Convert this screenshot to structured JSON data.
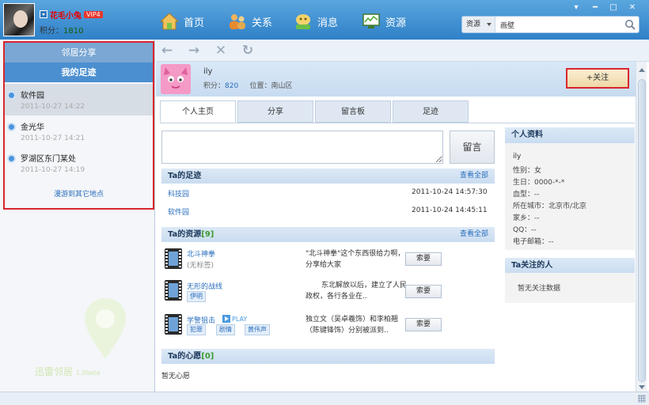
{
  "user": {
    "name": "花毛小兔",
    "vip": "VIP4",
    "score_label": "积分：",
    "score": "1810"
  },
  "nav": [
    {
      "label": "首页",
      "icon": "home-icon"
    },
    {
      "label": "关系",
      "icon": "people-icon"
    },
    {
      "label": "消息",
      "icon": "message-icon"
    },
    {
      "label": "资源",
      "icon": "monitor-icon"
    }
  ],
  "window_controls": {
    "menu": "▾",
    "minimize": "━",
    "maximize": "□",
    "close": "✕"
  },
  "search": {
    "type": "资源",
    "value": "画壁"
  },
  "left_panel": {
    "tab_share": "邻居分享",
    "tab_footprint": "我的足迹",
    "items": [
      {
        "name": "软件园",
        "time": "2011-10-27 14:22"
      },
      {
        "name": "金光华",
        "time": "2011-10-27 14:21"
      },
      {
        "name": "罗湖区东门某处",
        "time": "2011-10-27 14:19"
      }
    ],
    "roam_link": "漫游到其它地点",
    "watermark": {
      "name": "迅雷邻居",
      "version": "1.0beta"
    }
  },
  "profile": {
    "name": "ily",
    "score_label": "积分：",
    "score": "820",
    "location_label": "位置：",
    "location": "南山区",
    "follow_btn": "+关注"
  },
  "tabs": [
    "个人主页",
    "分享",
    "留言板",
    "足迹"
  ],
  "message": {
    "button": "留言"
  },
  "footprints_section": {
    "title": "Ta的足迹",
    "more": "查看全部",
    "rows": [
      {
        "place": "科技园",
        "time": "2011-10-24 14:57:30"
      },
      {
        "place": "软件园",
        "time": "2011-10-24 14:45:11"
      }
    ]
  },
  "resources_section": {
    "title": "Ta的资源",
    "count": "[9]",
    "more": "查看全部",
    "items": [
      {
        "title": "北斗神拳",
        "sub": "(无标签)",
        "desc": "\"北斗神拳\"这个东西很给力啊，分享给大家",
        "button": "索要"
      },
      {
        "title": "无形的战线",
        "tag": "伊明",
        "desc": "东北解放以后，建立了人民政权，各行各业在..",
        "button": "索要"
      },
      {
        "title": "学警狙击",
        "play": "PLAY",
        "tags": [
          "犯罪",
          "剧情",
          "黄伟声"
        ],
        "desc": "独立文（吴卓羲饰）和李柏翘（陈键锋饰）分别被派到..",
        "button": "索要"
      }
    ]
  },
  "wish_section": {
    "title": "Ta的心愿",
    "count": "[0]",
    "empty": "暂无心愿"
  },
  "personal_info": {
    "title": "个人资料",
    "name": "ily",
    "lines": [
      "性别：女",
      "生日：0000-*-*",
      "血型：--",
      "所在城市：北京市/北京",
      "家乡：--",
      "QQ：--",
      "电子邮箱：--"
    ]
  },
  "following": {
    "title": "Ta关注的人",
    "empty": "暂无关注数据"
  }
}
